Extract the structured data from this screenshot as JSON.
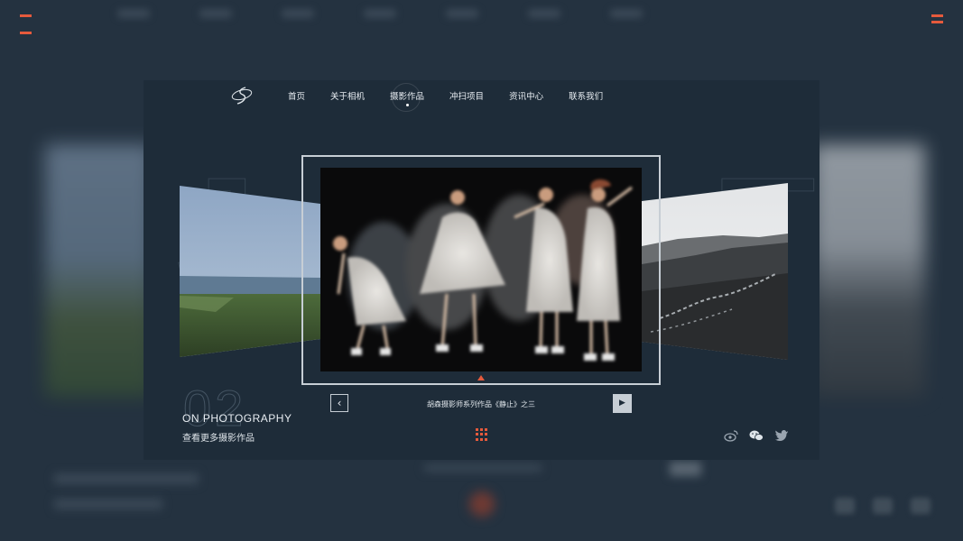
{
  "nav": {
    "items": [
      {
        "label": "首页"
      },
      {
        "label": "关于相机"
      },
      {
        "label": "摄影作品",
        "active": true
      },
      {
        "label": "冲扫项目"
      },
      {
        "label": "资讯中心"
      },
      {
        "label": "联系我们"
      }
    ]
  },
  "carousel": {
    "caption": "胡森摄影师系列作品《静止》之三",
    "prev_icon": "chevron-left-icon",
    "next_icon": "play-right-icon"
  },
  "section": {
    "number": "02",
    "title": "ON PHOTOGRAPHY",
    "subtitle": "查看更多摄影作品"
  },
  "social": [
    "weibo-icon",
    "wechat-icon",
    "twitter-icon"
  ],
  "colors": {
    "accent": "#e55a3c",
    "panel": "#1e2c39",
    "background": "#243240"
  }
}
